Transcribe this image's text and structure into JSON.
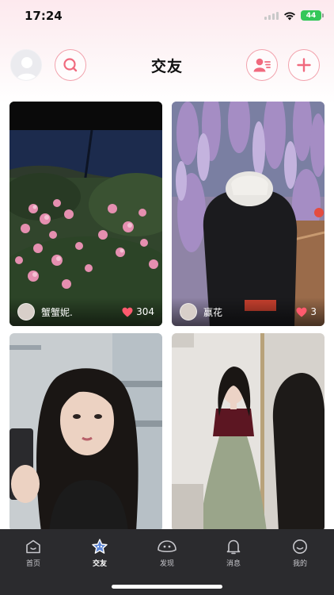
{
  "status_bar": {
    "time": "17:24",
    "battery": "44"
  },
  "header": {
    "title": "交友"
  },
  "feed": [
    {
      "user": "蟹蟹妮.",
      "likes": "304"
    },
    {
      "user": "赢花",
      "likes": "3"
    },
    {
      "user": "",
      "likes": ""
    },
    {
      "user": "",
      "likes": ""
    }
  ],
  "bottom_nav": [
    {
      "label": "首页",
      "icon": "home-icon"
    },
    {
      "label": "交友",
      "icon": "friends-star-icon",
      "active": true
    },
    {
      "label": "发现",
      "icon": "discover-icon"
    },
    {
      "label": "消息",
      "icon": "bell-icon"
    },
    {
      "label": "我的",
      "icon": "profile-icon"
    }
  ],
  "colors": {
    "accent": "#f06a7e",
    "nav_bg": "#2b2b2e"
  }
}
